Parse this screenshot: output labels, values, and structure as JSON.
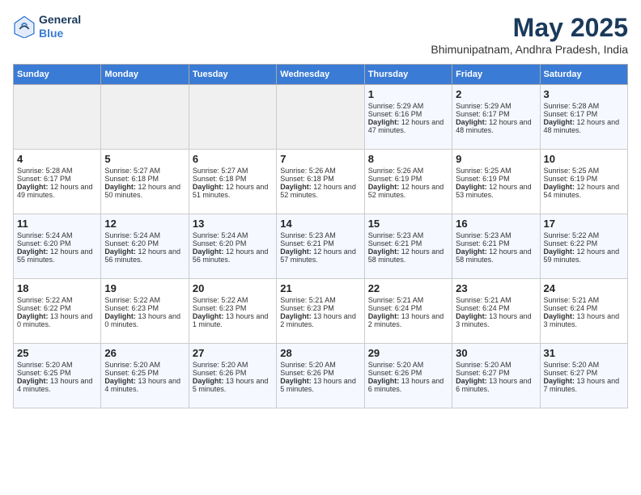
{
  "header": {
    "logo_general": "General",
    "logo_blue": "Blue",
    "month": "May 2025",
    "location": "Bhimunipatnam, Andhra Pradesh, India"
  },
  "weekdays": [
    "Sunday",
    "Monday",
    "Tuesday",
    "Wednesday",
    "Thursday",
    "Friday",
    "Saturday"
  ],
  "weeks": [
    [
      {
        "day": "",
        "sunrise": "",
        "sunset": "",
        "daylight": ""
      },
      {
        "day": "",
        "sunrise": "",
        "sunset": "",
        "daylight": ""
      },
      {
        "day": "",
        "sunrise": "",
        "sunset": "",
        "daylight": ""
      },
      {
        "day": "",
        "sunrise": "",
        "sunset": "",
        "daylight": ""
      },
      {
        "day": "1",
        "sunrise": "Sunrise: 5:29 AM",
        "sunset": "Sunset: 6:16 PM",
        "daylight": "Daylight: 12 hours and 47 minutes."
      },
      {
        "day": "2",
        "sunrise": "Sunrise: 5:29 AM",
        "sunset": "Sunset: 6:17 PM",
        "daylight": "Daylight: 12 hours and 48 minutes."
      },
      {
        "day": "3",
        "sunrise": "Sunrise: 5:28 AM",
        "sunset": "Sunset: 6:17 PM",
        "daylight": "Daylight: 12 hours and 48 minutes."
      }
    ],
    [
      {
        "day": "4",
        "sunrise": "Sunrise: 5:28 AM",
        "sunset": "Sunset: 6:17 PM",
        "daylight": "Daylight: 12 hours and 49 minutes."
      },
      {
        "day": "5",
        "sunrise": "Sunrise: 5:27 AM",
        "sunset": "Sunset: 6:18 PM",
        "daylight": "Daylight: 12 hours and 50 minutes."
      },
      {
        "day": "6",
        "sunrise": "Sunrise: 5:27 AM",
        "sunset": "Sunset: 6:18 PM",
        "daylight": "Daylight: 12 hours and 51 minutes."
      },
      {
        "day": "7",
        "sunrise": "Sunrise: 5:26 AM",
        "sunset": "Sunset: 6:18 PM",
        "daylight": "Daylight: 12 hours and 52 minutes."
      },
      {
        "day": "8",
        "sunrise": "Sunrise: 5:26 AM",
        "sunset": "Sunset: 6:19 PM",
        "daylight": "Daylight: 12 hours and 52 minutes."
      },
      {
        "day": "9",
        "sunrise": "Sunrise: 5:25 AM",
        "sunset": "Sunset: 6:19 PM",
        "daylight": "Daylight: 12 hours and 53 minutes."
      },
      {
        "day": "10",
        "sunrise": "Sunrise: 5:25 AM",
        "sunset": "Sunset: 6:19 PM",
        "daylight": "Daylight: 12 hours and 54 minutes."
      }
    ],
    [
      {
        "day": "11",
        "sunrise": "Sunrise: 5:24 AM",
        "sunset": "Sunset: 6:20 PM",
        "daylight": "Daylight: 12 hours and 55 minutes."
      },
      {
        "day": "12",
        "sunrise": "Sunrise: 5:24 AM",
        "sunset": "Sunset: 6:20 PM",
        "daylight": "Daylight: 12 hours and 56 minutes."
      },
      {
        "day": "13",
        "sunrise": "Sunrise: 5:24 AM",
        "sunset": "Sunset: 6:20 PM",
        "daylight": "Daylight: 12 hours and 56 minutes."
      },
      {
        "day": "14",
        "sunrise": "Sunrise: 5:23 AM",
        "sunset": "Sunset: 6:21 PM",
        "daylight": "Daylight: 12 hours and 57 minutes."
      },
      {
        "day": "15",
        "sunrise": "Sunrise: 5:23 AM",
        "sunset": "Sunset: 6:21 PM",
        "daylight": "Daylight: 12 hours and 58 minutes."
      },
      {
        "day": "16",
        "sunrise": "Sunrise: 5:23 AM",
        "sunset": "Sunset: 6:21 PM",
        "daylight": "Daylight: 12 hours and 58 minutes."
      },
      {
        "day": "17",
        "sunrise": "Sunrise: 5:22 AM",
        "sunset": "Sunset: 6:22 PM",
        "daylight": "Daylight: 12 hours and 59 minutes."
      }
    ],
    [
      {
        "day": "18",
        "sunrise": "Sunrise: 5:22 AM",
        "sunset": "Sunset: 6:22 PM",
        "daylight": "Daylight: 13 hours and 0 minutes."
      },
      {
        "day": "19",
        "sunrise": "Sunrise: 5:22 AM",
        "sunset": "Sunset: 6:23 PM",
        "daylight": "Daylight: 13 hours and 0 minutes."
      },
      {
        "day": "20",
        "sunrise": "Sunrise: 5:22 AM",
        "sunset": "Sunset: 6:23 PM",
        "daylight": "Daylight: 13 hours and 1 minute."
      },
      {
        "day": "21",
        "sunrise": "Sunrise: 5:21 AM",
        "sunset": "Sunset: 6:23 PM",
        "daylight": "Daylight: 13 hours and 2 minutes."
      },
      {
        "day": "22",
        "sunrise": "Sunrise: 5:21 AM",
        "sunset": "Sunset: 6:24 PM",
        "daylight": "Daylight: 13 hours and 2 minutes."
      },
      {
        "day": "23",
        "sunrise": "Sunrise: 5:21 AM",
        "sunset": "Sunset: 6:24 PM",
        "daylight": "Daylight: 13 hours and 3 minutes."
      },
      {
        "day": "24",
        "sunrise": "Sunrise: 5:21 AM",
        "sunset": "Sunset: 6:24 PM",
        "daylight": "Daylight: 13 hours and 3 minutes."
      }
    ],
    [
      {
        "day": "25",
        "sunrise": "Sunrise: 5:20 AM",
        "sunset": "Sunset: 6:25 PM",
        "daylight": "Daylight: 13 hours and 4 minutes."
      },
      {
        "day": "26",
        "sunrise": "Sunrise: 5:20 AM",
        "sunset": "Sunset: 6:25 PM",
        "daylight": "Daylight: 13 hours and 4 minutes."
      },
      {
        "day": "27",
        "sunrise": "Sunrise: 5:20 AM",
        "sunset": "Sunset: 6:26 PM",
        "daylight": "Daylight: 13 hours and 5 minutes."
      },
      {
        "day": "28",
        "sunrise": "Sunrise: 5:20 AM",
        "sunset": "Sunset: 6:26 PM",
        "daylight": "Daylight: 13 hours and 5 minutes."
      },
      {
        "day": "29",
        "sunrise": "Sunrise: 5:20 AM",
        "sunset": "Sunset: 6:26 PM",
        "daylight": "Daylight: 13 hours and 6 minutes."
      },
      {
        "day": "30",
        "sunrise": "Sunrise: 5:20 AM",
        "sunset": "Sunset: 6:27 PM",
        "daylight": "Daylight: 13 hours and 6 minutes."
      },
      {
        "day": "31",
        "sunrise": "Sunrise: 5:20 AM",
        "sunset": "Sunset: 6:27 PM",
        "daylight": "Daylight: 13 hours and 7 minutes."
      }
    ]
  ]
}
